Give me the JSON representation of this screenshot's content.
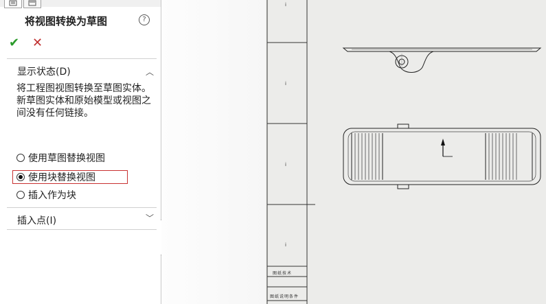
{
  "panel": {
    "title": "将视图转换为草图",
    "help_icon": "?",
    "ok_icon": "✔",
    "cancel_icon": "✕",
    "display_state": {
      "header": "显示状态(D)",
      "description": "将工程图视图转换至草图实体。新草图实体和原始模型或视图之间没有任何链接。",
      "options": [
        {
          "label": "使用草图替换视图",
          "selected": false
        },
        {
          "label": "使用块替换视图",
          "selected": true
        },
        {
          "label": "插入作为块",
          "selected": false
        }
      ]
    },
    "insert_point": {
      "header": "插入点(I)"
    }
  },
  "drawing": {
    "title_block_1": "图纸技术",
    "title_block_2": "图纸说明条件"
  },
  "colors": {
    "accent_ok": "#2a9a2a",
    "accent_cancel": "#c03030",
    "highlight": "#c83030"
  }
}
